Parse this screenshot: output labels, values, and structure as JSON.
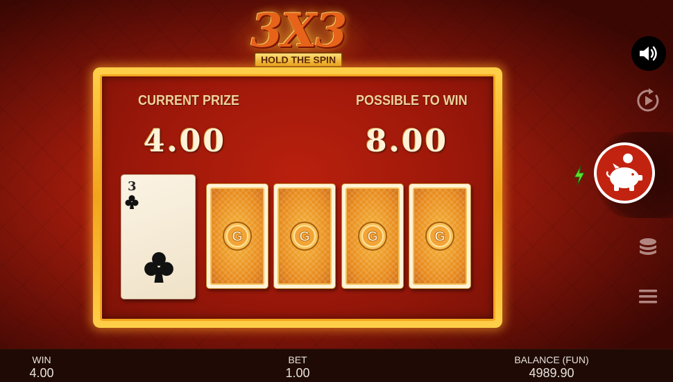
{
  "logo": {
    "main": "3X3",
    "sub": "HOLD THE SPIN"
  },
  "panel": {
    "current_prize_label": "CURRENT PRIZE",
    "current_prize_value": "4.00",
    "possible_label": "POSSIBLE TO WIN",
    "possible_value": "8.00"
  },
  "cards": {
    "revealed": {
      "rank": "3",
      "suit": "clubs"
    },
    "face_down_count": 4,
    "back_emblem": "G"
  },
  "controls": {
    "sound": "speaker-icon",
    "autoplay": "autoplay-icon",
    "piggy": "piggy-bank-icon",
    "boost": "lightning-icon",
    "chips": "chip-stack-icon",
    "menu": "menu-icon"
  },
  "bottom_bar": {
    "win_label": "WIN",
    "win_value": "4.00",
    "bet_label": "BET",
    "bet_value": "1.00",
    "balance_label": "BALANCE (FUN)",
    "balance_value": "4989.90"
  },
  "colors": {
    "frame_gold": "#f0a51b",
    "background_red": "#9a1a0b",
    "bar_dark": "#1f0a05"
  }
}
